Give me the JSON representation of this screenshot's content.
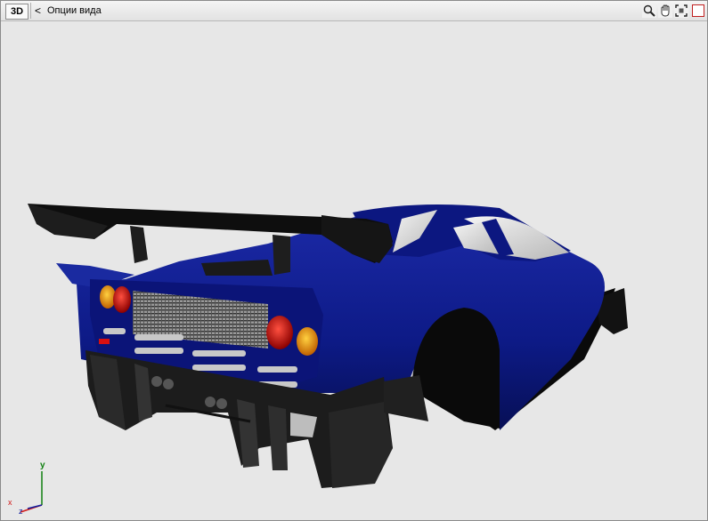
{
  "toolbar": {
    "view_mode_label": "3D",
    "back_glyph": "<",
    "view_options_label": "Опции вида",
    "tools": [
      "zoom-icon",
      "pan-hand-icon",
      "fit-view-icon",
      "close-view-icon"
    ]
  },
  "viewport": {
    "background_color": "#e7e7e7",
    "car_body_color": "#0a1688"
  },
  "axis_gizmo": {
    "x_label": "x",
    "y_label": "y",
    "z_label": "z",
    "x_color": "#d01818",
    "y_color": "#108010",
    "z_color": "#1020a0"
  }
}
